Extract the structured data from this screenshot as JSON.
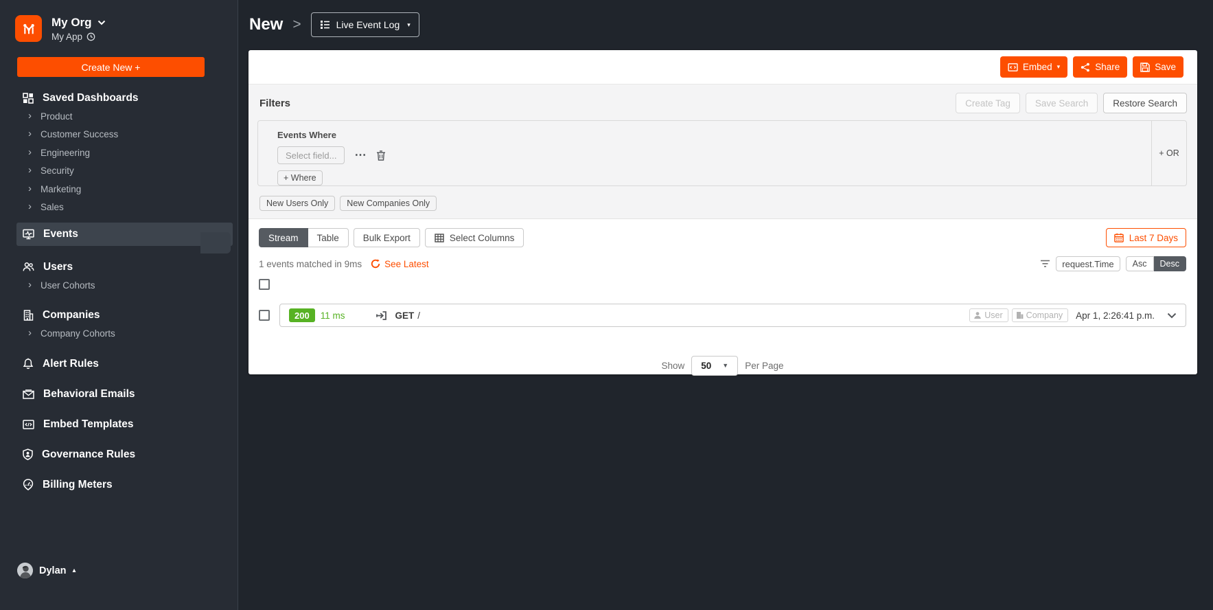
{
  "sidebar": {
    "org_name": "My Org",
    "app_name": "My App",
    "create_new_label": "Create New +",
    "sections": [
      {
        "label": "Saved Dashboards",
        "children": [
          "Product",
          "Customer Success",
          "Engineering",
          "Security",
          "Marketing",
          "Sales"
        ]
      },
      {
        "label": "Events"
      },
      {
        "label": "Users",
        "children": [
          "User Cohorts"
        ]
      },
      {
        "label": "Companies",
        "children": [
          "Company Cohorts"
        ]
      },
      {
        "label": "Alert Rules"
      },
      {
        "label": "Behavioral Emails"
      },
      {
        "label": "Embed Templates"
      },
      {
        "label": "Governance Rules"
      },
      {
        "label": "Billing Meters"
      }
    ],
    "user_name": "Dylan"
  },
  "header": {
    "title": "New",
    "separator": ">",
    "view_selector": "Live Event Log"
  },
  "actions": {
    "embed": "Embed",
    "share": "Share",
    "save": "Save"
  },
  "filters": {
    "heading": "Filters",
    "create_tag": "Create Tag",
    "save_search": "Save Search",
    "restore_search": "Restore Search",
    "group_title": "Events Where",
    "field_placeholder": "Select field...",
    "add_where": "+ Where",
    "add_or": "+ OR",
    "quick_filters": [
      "New Users Only",
      "New Companies Only"
    ]
  },
  "results": {
    "tabs": {
      "stream": "Stream",
      "table": "Table"
    },
    "bulk_export": "Bulk Export",
    "select_columns": "Select Columns",
    "date_range": "Last 7 Days",
    "summary": "1 events matched in 9ms",
    "see_latest": "See Latest",
    "sort": {
      "field": "request.Time",
      "asc": "Asc",
      "desc": "Desc"
    },
    "event": {
      "status_code": "200",
      "latency": "11 ms",
      "method": "GET",
      "path": "/",
      "user_label": "User",
      "company_label": "Company",
      "timestamp": "Apr 1, 2:26:41 p.m."
    },
    "pagination": {
      "show_label": "Show",
      "page_size": "50",
      "per_page_label": "Per Page"
    }
  },
  "icons": {
    "caret_down": "▾",
    "caret_up": "▴",
    "select_caret": "▼",
    "chevron_right": "›",
    "ellipsis": "⋯"
  },
  "colors": {
    "accent": "#fd4e00",
    "success_green": "#57b224",
    "sidebar_bg": "#272c34",
    "canvas_bg": "#20252c",
    "active_segment": "#565b61"
  }
}
